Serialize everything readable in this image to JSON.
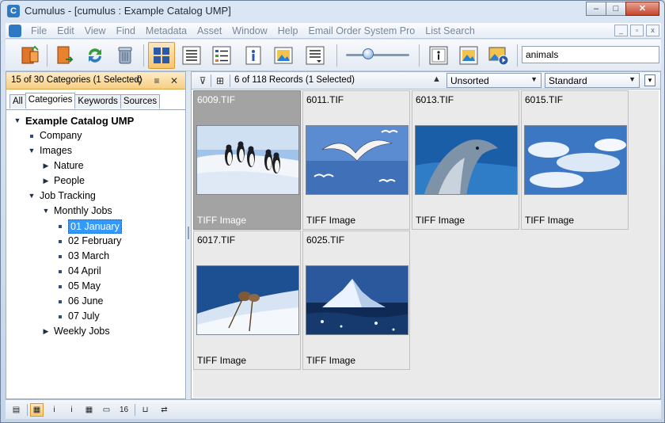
{
  "window": {
    "title": "Cumulus - [cumulus : Example Catalog UMP]",
    "app_icon_glyph": "C",
    "controls": {
      "minimize": "–",
      "maximize": "□",
      "close": "✕"
    }
  },
  "menubar": {
    "items": [
      "File",
      "Edit",
      "View",
      "Find",
      "Metadata",
      "Asset",
      "Window",
      "Help",
      "Email Order System Pro",
      "List Search"
    ],
    "mdi_controls": [
      "_",
      "▫",
      "x"
    ]
  },
  "toolbar": {
    "buttons": [
      {
        "icon": "open-collection-icon",
        "color": "#e0762a"
      },
      {
        "icon": "catalog-assets-icon",
        "color": "#e9822f"
      },
      {
        "icon": "refresh-icon",
        "color": "#3a9a3a"
      },
      {
        "icon": "trash-icon",
        "color": "#7b8ca3"
      },
      {
        "icon": "thumbnail-view-icon",
        "color": "#2b5aa8",
        "active": true
      },
      {
        "icon": "list-view-icon",
        "color": "#333333"
      },
      {
        "icon": "details-view-icon",
        "color": "#333333"
      },
      {
        "icon": "info-icon",
        "color": "#2b5aa8"
      },
      {
        "icon": "preview-icon",
        "color": "#e0a030"
      },
      {
        "icon": "layout-options-icon",
        "color": "#333333"
      },
      {
        "icon": "info-window-icon",
        "color": "#333333"
      },
      {
        "icon": "preview-window-icon",
        "color": "#2b5aa8"
      },
      {
        "icon": "slideshow-icon",
        "color": "#2b5aa8"
      }
    ],
    "zoom_slider": 0.3,
    "search_value": "animals"
  },
  "categories": {
    "count_text": "15 of 30 Categories (1 Selected)",
    "header_icons": {
      "assign": "⚲",
      "menu": "≡",
      "close": "✕"
    },
    "tabs": [
      {
        "label": "All",
        "selected": false
      },
      {
        "label": "Categories",
        "selected": true
      },
      {
        "label": "Keywords",
        "selected": false
      },
      {
        "label": "Sources",
        "selected": false
      }
    ],
    "tree": [
      {
        "label": "Example Catalog UMP",
        "level": 0,
        "kind": "expanded",
        "root": true
      },
      {
        "label": "Company",
        "level": 1,
        "kind": "leaf"
      },
      {
        "label": "Images",
        "level": 1,
        "kind": "expanded"
      },
      {
        "label": "Nature",
        "level": 2,
        "kind": "collapsed"
      },
      {
        "label": "People",
        "level": 2,
        "kind": "collapsed"
      },
      {
        "label": "Job Tracking",
        "level": 1,
        "kind": "expanded"
      },
      {
        "label": "Monthly Jobs",
        "level": 2,
        "kind": "expanded"
      },
      {
        "label": "01 January",
        "level": 3,
        "kind": "leaf",
        "selected": true
      },
      {
        "label": "02 February",
        "level": 3,
        "kind": "leaf"
      },
      {
        "label": "03 March",
        "level": 3,
        "kind": "leaf"
      },
      {
        "label": "04 April",
        "level": 3,
        "kind": "leaf"
      },
      {
        "label": "05 May",
        "level": 3,
        "kind": "leaf"
      },
      {
        "label": "06 June",
        "level": 3,
        "kind": "leaf"
      },
      {
        "label": "07 July",
        "level": 3,
        "kind": "leaf"
      },
      {
        "label": "Weekly Jobs",
        "level": 2,
        "kind": "collapsed"
      }
    ]
  },
  "records": {
    "filter_icon": "⊽",
    "tree_icon": "⊞",
    "count_text": "6 of 118 Records (1 Selected)",
    "sort_icon": "▲",
    "sort_value": "Unsorted",
    "view_value": "Standard",
    "items": [
      {
        "name": "6009.TIF",
        "type": "TIFF Image",
        "selected": true,
        "scene": "penguins"
      },
      {
        "name": "6011.TIF",
        "type": "TIFF Image",
        "selected": false,
        "scene": "gulls"
      },
      {
        "name": "6013.TIF",
        "type": "TIFF Image",
        "selected": false,
        "scene": "dolphin"
      },
      {
        "name": "6015.TIF",
        "type": "TIFF Image",
        "selected": false,
        "scene": "clouds"
      },
      {
        "name": "6017.TIF",
        "type": "TIFF Image",
        "selected": false,
        "scene": "frost-plant"
      },
      {
        "name": "6025.TIF",
        "type": "TIFF Image",
        "selected": false,
        "scene": "iceberg"
      }
    ]
  },
  "bottombar": {
    "buttons": [
      {
        "icon": "catalog-info-icon",
        "glyph": "▤",
        "active": false
      },
      {
        "icon": "record-list-icon",
        "glyph": "▦",
        "active": true
      },
      {
        "icon": "info-small-icon",
        "glyph": "i",
        "active": false
      },
      {
        "icon": "info-alt-icon",
        "glyph": "i",
        "active": false
      },
      {
        "icon": "grid-small-icon",
        "glyph": "▦",
        "active": false
      },
      {
        "icon": "window-icon",
        "glyph": "▭",
        "active": false
      },
      {
        "icon": "counter-icon",
        "glyph": "16",
        "active": false
      },
      {
        "icon": "basket-icon",
        "glyph": "⊔",
        "active": false
      },
      {
        "icon": "workflow-icon",
        "glyph": "⇄",
        "active": false
      }
    ]
  }
}
